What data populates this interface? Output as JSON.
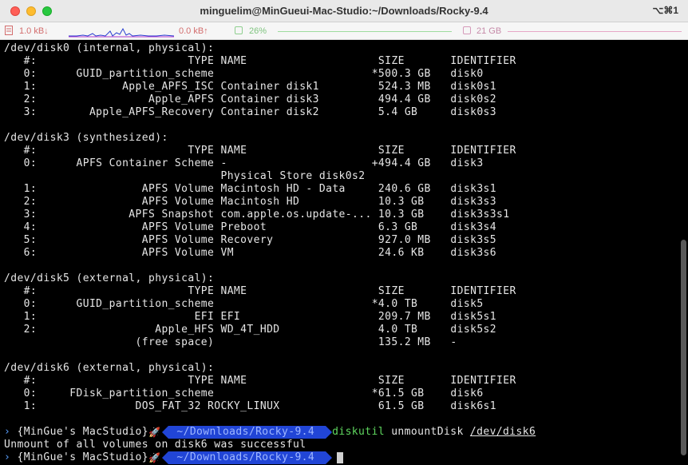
{
  "window": {
    "title": "minguelim@MinGueui-Mac-Studio:~/Downloads/Rocky-9.4",
    "shortcut": "⌥⌘1"
  },
  "statusbar": {
    "net_down": "1.0 kB↓",
    "net_up": "0.0 kB↑",
    "cpu": "26%",
    "memory": "21 GB"
  },
  "terminal": {
    "lines": [
      "/dev/disk0 (internal, physical):",
      "   #:                       TYPE NAME                    SIZE       IDENTIFIER",
      "   0:      GUID_partition_scheme                        *500.3 GB   disk0",
      "   1:             Apple_APFS_ISC Container disk1         524.3 MB   disk0s1",
      "   2:                 Apple_APFS Container disk3         494.4 GB   disk0s2",
      "   3:        Apple_APFS_Recovery Container disk2         5.4 GB     disk0s3",
      "",
      "/dev/disk3 (synthesized):",
      "   #:                       TYPE NAME                    SIZE       IDENTIFIER",
      "   0:      APFS Container Scheme -                      +494.4 GB   disk3",
      "                                 Physical Store disk0s2",
      "   1:                APFS Volume Macintosh HD - Data     240.6 GB   disk3s1",
      "   2:                APFS Volume Macintosh HD            10.3 GB    disk3s3",
      "   3:              APFS Snapshot com.apple.os.update-... 10.3 GB    disk3s3s1",
      "   4:                APFS Volume Preboot                 6.3 GB     disk3s4",
      "   5:                APFS Volume Recovery                927.0 MB   disk3s5",
      "   6:                APFS Volume VM                      24.6 KB    disk3s6",
      "",
      "/dev/disk5 (external, physical):",
      "   #:                       TYPE NAME                    SIZE       IDENTIFIER",
      "   0:      GUID_partition_scheme                        *4.0 TB     disk5",
      "   1:                        EFI EFI                     209.7 MB   disk5s1",
      "   2:                  Apple_HFS WD_4T_HDD               4.0 TB     disk5s2",
      "                    (free space)                         135.2 MB   -",
      "",
      "/dev/disk6 (external, physical):",
      "   #:                       TYPE NAME                    SIZE       IDENTIFIER",
      "   0:     FDisk_partition_scheme                        *61.5 GB    disk6",
      "   1:               DOS_FAT_32 ROCKY_LINUX               61.5 GB    disk6s1"
    ],
    "prompt1": {
      "host": "{MinGue's MacStudio}",
      "rocket": "🚀",
      "path": "~/Downloads/Rocky-9.4",
      "command": "diskutil",
      "args": "unmountDisk",
      "device": "/dev/disk6"
    },
    "output": "Unmount of all volumes on disk6 was successful",
    "prompt2": {
      "host": "{MinGue's MacStudio}",
      "rocket": "🚀",
      "path": "~/Downloads/Rocky-9.4"
    }
  }
}
